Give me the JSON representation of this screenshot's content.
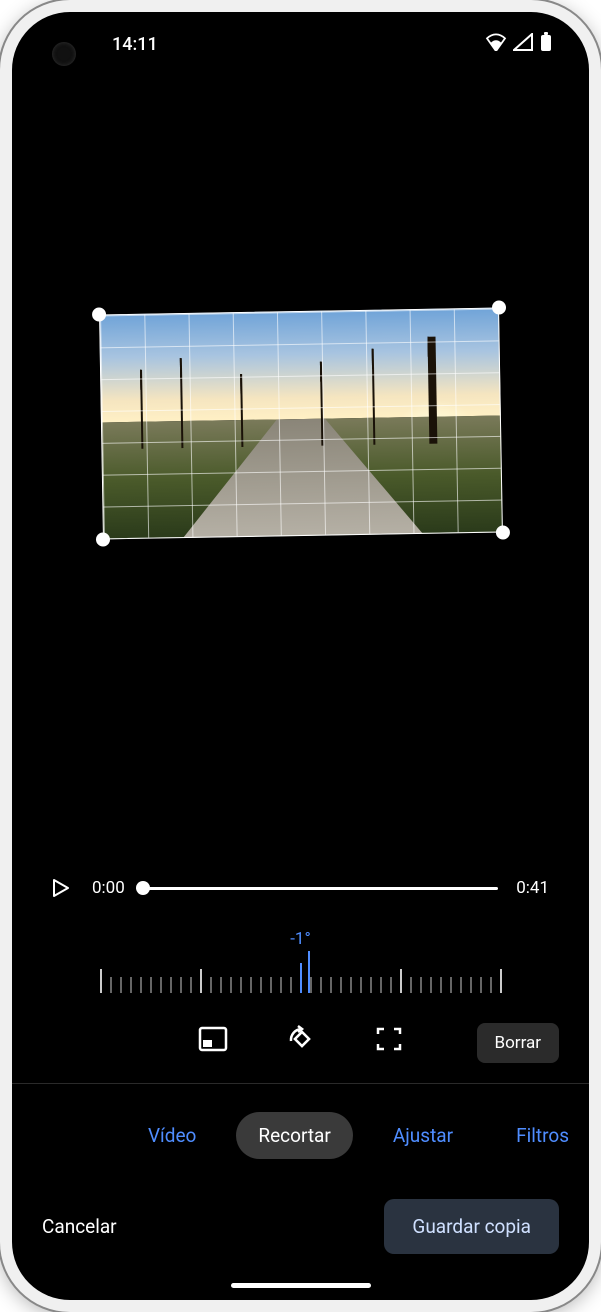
{
  "statusbar": {
    "time": "14:11"
  },
  "playback": {
    "current": "0:00",
    "total": "0:41"
  },
  "rotation": {
    "value": "-1°"
  },
  "tools": {
    "clear": "Borrar"
  },
  "tabs": {
    "video": "Vídeo",
    "crop": "Recortar",
    "adjust": "Ajustar",
    "filters": "Filtros"
  },
  "actions": {
    "cancel": "Cancelar",
    "save_copy": "Guardar copia"
  }
}
